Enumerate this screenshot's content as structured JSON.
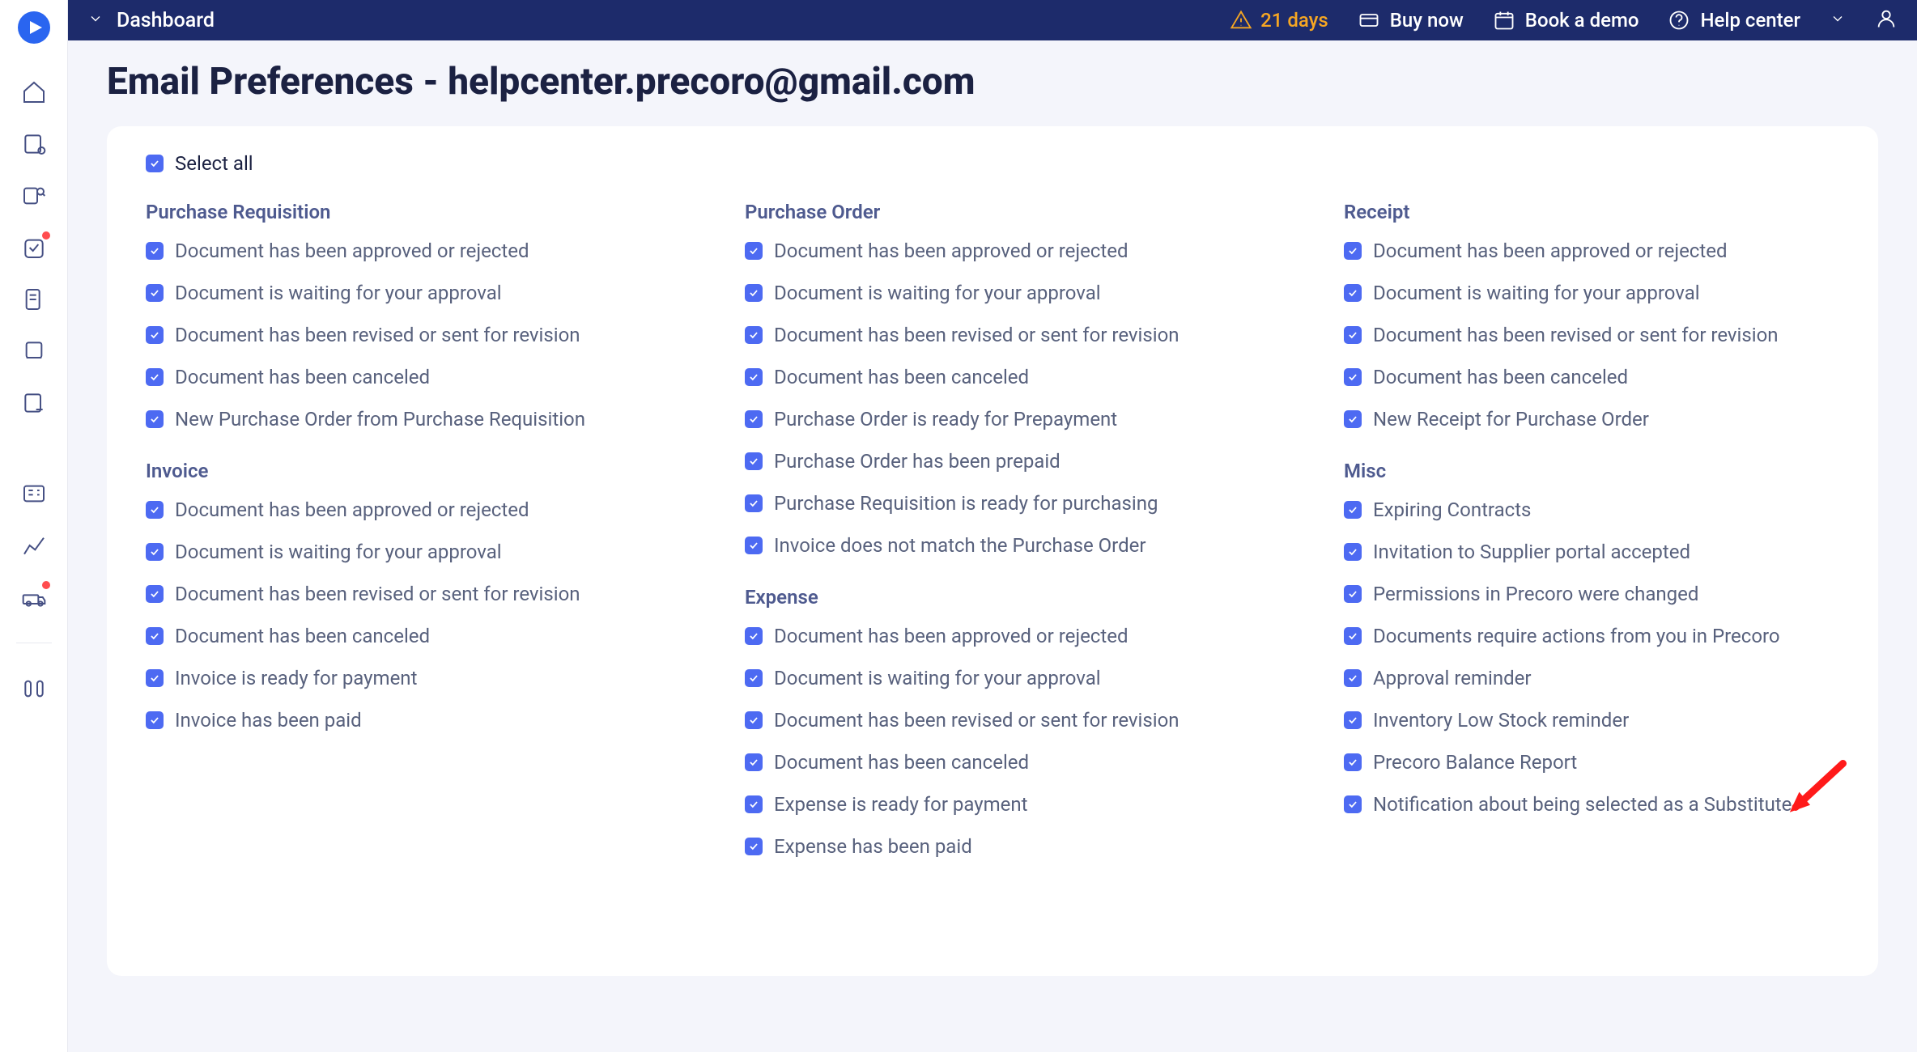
{
  "header": {
    "breadcrumb": "Dashboard",
    "trial_days": "21 days",
    "buy_now": "Buy now",
    "book_demo": "Book a demo",
    "help_center": "Help center"
  },
  "page_title": "Email Preferences - helpcenter.precoro@gmail.com",
  "select_all_label": "Select all",
  "groups": {
    "pr": {
      "title": "Purchase Requisition",
      "items": [
        "Document has been approved or rejected",
        "Document is waiting for your approval",
        "Document has been revised or sent for revision",
        "Document has been canceled",
        "New Purchase Order from Purchase Requisition"
      ]
    },
    "po": {
      "title": "Purchase Order",
      "items": [
        "Document has been approved or rejected",
        "Document is waiting for your approval",
        "Document has been revised or sent for revision",
        "Document has been canceled",
        "Purchase Order is ready for Prepayment",
        "Purchase Order has been prepaid",
        "Purchase Requisition is ready for purchasing",
        "Invoice does not match the Purchase Order"
      ]
    },
    "receipt": {
      "title": "Receipt",
      "items": [
        "Document has been approved or rejected",
        "Document is waiting for your approval",
        "Document has been revised or sent for revision",
        "Document has been canceled",
        "New Receipt for Purchase Order"
      ]
    },
    "invoice": {
      "title": "Invoice",
      "items": [
        "Document has been approved or rejected",
        "Document is waiting for your approval",
        "Document has been revised or sent for revision",
        "Document has been canceled",
        "Invoice is ready for payment",
        "Invoice has been paid"
      ]
    },
    "expense": {
      "title": "Expense",
      "items": [
        "Document has been approved or rejected",
        "Document is waiting for your approval",
        "Document has been revised or sent for revision",
        "Document has been canceled",
        "Expense is ready for payment",
        "Expense has been paid"
      ]
    },
    "misc": {
      "title": "Misc",
      "items": [
        "Expiring Contracts",
        "Invitation to Supplier portal accepted",
        "Permissions in Precoro were changed",
        "Documents require actions from you in Precoro",
        "Approval reminder",
        "Inventory Low Stock reminder",
        "Precoro Balance Report",
        "Notification about being selected as a Substitute"
      ]
    }
  }
}
